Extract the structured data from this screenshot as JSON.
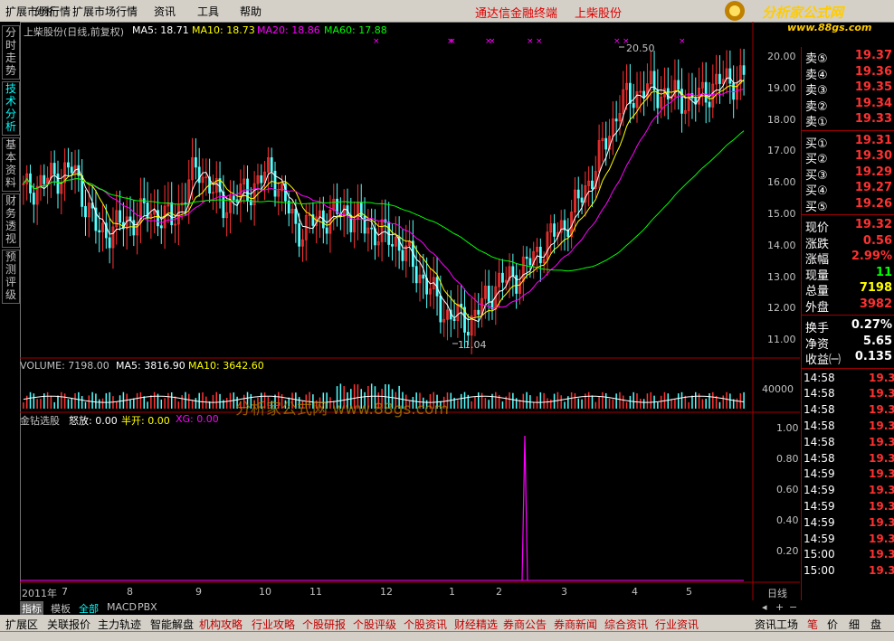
{
  "menu": [
    "扩展市场行情",
    "分析",
    "扩展市场行情",
    "资讯",
    "工具",
    "帮助"
  ],
  "brand": {
    "left": "通达信金融终端",
    "stock": "上柴股份"
  },
  "logo": {
    "text": "分析家公式网",
    "url": "www.88gs.com"
  },
  "left_tabs": [
    "分时走势",
    "技术分析",
    "基本资料",
    "财务透视",
    "预测评级"
  ],
  "main_header": {
    "title": "上柴股份(日线,前复权)",
    "ma5": "MA5: 18.71",
    "ma10": "MA10: 18.73",
    "ma20": "MA20: 18.86",
    "ma60": "MA60: 17.88",
    "high_label": "20.50",
    "low_label": "11.04"
  },
  "price_axis": [
    "20.00",
    "19.00",
    "18.00",
    "17.00",
    "16.00",
    "15.00",
    "14.00",
    "13.00",
    "12.00",
    "11.00"
  ],
  "volume_header": {
    "vol": "VOLUME: 7198.00",
    "ma5": "MA5: 3816.90",
    "ma10": "MA10: 3642.60",
    "axis": "40000"
  },
  "watermark": "分析家公式网 www.88gs.com",
  "indicator_header": {
    "name": "金钻选股",
    "a": "怒放: 0.00",
    "b": "半开: 0.00",
    "c": "XG: 0.00"
  },
  "indicator_axis": [
    "1.00",
    "0.80",
    "0.60",
    "0.40",
    "0.20"
  ],
  "time_axis": [
    "2011年",
    "7",
    "8",
    "9",
    "10",
    "11",
    "12",
    "1",
    "2",
    "3",
    "4",
    "5"
  ],
  "period": "日线",
  "chart_data": {
    "type": "candlestick",
    "title": "上柴股份(日线,前复权)",
    "price_range": [
      11.0,
      20.5
    ],
    "high": 20.5,
    "low": 11.04,
    "ma": {
      "MA5": 18.71,
      "MA10": 18.73,
      "MA20": 18.86,
      "MA60": 17.88
    },
    "ma_colors": {
      "MA5": "#ffffff",
      "MA10": "#ffff00",
      "MA20": "#ff00ff",
      "MA60": "#00ff00"
    },
    "months": [
      "7",
      "8",
      "9",
      "10",
      "11",
      "12",
      "1",
      "2",
      "3",
      "4",
      "5"
    ],
    "closes_approx": [
      15.8,
      16.2,
      16.5,
      14.5,
      14.8,
      15.2,
      14.9,
      16.6,
      15.4,
      15.8,
      16.5,
      14.6,
      15.0,
      15.2,
      14.6,
      14.3,
      13.2,
      12.0,
      11.8,
      12.9,
      13.3,
      14.2,
      15.0,
      16.5,
      18.5,
      19.0,
      18.8,
      18.6,
      19.2,
      19.3
    ],
    "volume": {
      "VOLUME": 7198.0,
      "MA5": 3816.9,
      "MA10": 3642.6
    },
    "indicator": {
      "name": "金钻选股",
      "怒放": 0.0,
      "半开": 0.0,
      "XG": 0.0,
      "axis": [
        0.2,
        1.0
      ]
    }
  },
  "quote": [
    {
      "label": "卖⑤",
      "value": "19.37"
    },
    {
      "label": "卖④",
      "value": "19.36"
    },
    {
      "label": "卖③",
      "value": "19.35"
    },
    {
      "label": "卖②",
      "value": "19.34"
    },
    {
      "label": "卖①",
      "value": "19.33"
    },
    {
      "label": "买①",
      "value": "19.31"
    },
    {
      "label": "买②",
      "value": "19.30"
    },
    {
      "label": "买③",
      "value": "19.29"
    },
    {
      "label": "买④",
      "value": "19.27"
    },
    {
      "label": "买⑤",
      "value": "19.26"
    }
  ],
  "stats": [
    {
      "label": "现价",
      "value": "19.32"
    },
    {
      "label": "涨跌",
      "value": "0.56"
    },
    {
      "label": "涨幅",
      "value": "2.99%"
    },
    {
      "label": "现量",
      "value": "11"
    },
    {
      "label": "总量",
      "value": "7198"
    },
    {
      "label": "外盘",
      "value": "3982"
    }
  ],
  "stats2": [
    {
      "label": "换手",
      "value": "0.27%"
    },
    {
      "label": "净资",
      "value": "5.65"
    },
    {
      "label": "收益㈠",
      "value": "0.135"
    }
  ],
  "ticks": [
    {
      "t": "14:58",
      "p": "19.3"
    },
    {
      "t": "14:58",
      "p": "19.3"
    },
    {
      "t": "14:58",
      "p": "19.3"
    },
    {
      "t": "14:58",
      "p": "19.3"
    },
    {
      "t": "14:58",
      "p": "19.3"
    },
    {
      "t": "14:58",
      "p": "19.3"
    },
    {
      "t": "14:59",
      "p": "19.3"
    },
    {
      "t": "14:59",
      "p": "19.3"
    },
    {
      "t": "14:59",
      "p": "19.3"
    },
    {
      "t": "14:59",
      "p": "19.3"
    },
    {
      "t": "14:59",
      "p": "19.3"
    },
    {
      "t": "15:00",
      "p": "19.3"
    },
    {
      "t": "15:00",
      "p": "19.3"
    }
  ],
  "bottom_tabs": [
    "指标",
    "模板",
    "全部",
    "MACD",
    "PBX"
  ],
  "bottom_bar": [
    "扩展区",
    "关联报价",
    "主力轨迹",
    "智能解盘",
    "机构攻略",
    "行业攻略",
    "个股研报",
    "个股评级",
    "个股资讯",
    "财经精选",
    "券商公告",
    "券商新闻",
    "综合资讯",
    "行业资讯"
  ],
  "bottom_right": {
    "left": "资讯工场",
    "tabs": [
      "笔",
      "价",
      "细",
      "盘"
    ]
  }
}
